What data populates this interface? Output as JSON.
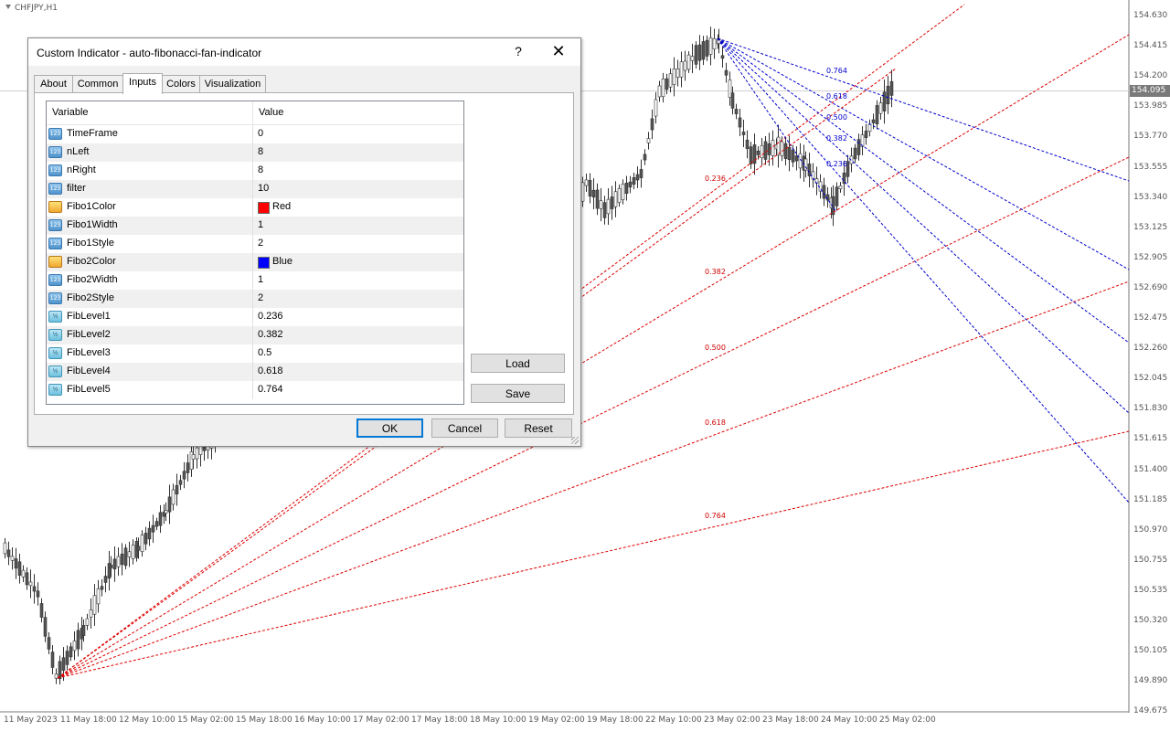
{
  "chart": {
    "symbol": "CHFJPY,H1",
    "current_price": "154.095",
    "price_scale": [
      "154.630",
      "154.415",
      "154.200",
      "153.985",
      "153.770",
      "153.555",
      "153.340",
      "153.125",
      "152.905",
      "152.690",
      "152.475",
      "152.260",
      "152.045",
      "151.830",
      "151.615",
      "151.400",
      "151.185",
      "150.970",
      "150.755",
      "150.535",
      "150.320",
      "150.105",
      "149.890",
      "149.675"
    ],
    "time_scale": [
      "11 May 2023",
      "11 May 18:00",
      "12 May 10:00",
      "15 May 02:00",
      "15 May 18:00",
      "16 May 10:00",
      "17 May 02:00",
      "17 May 18:00",
      "18 May 10:00",
      "19 May 02:00",
      "19 May 18:00",
      "22 May 10:00",
      "23 May 02:00",
      "23 May 18:00",
      "24 May 10:00",
      "25 May 02:00"
    ],
    "red_fan_labels": [
      "0.236",
      "0.382",
      "0.500",
      "0.618",
      "0.764"
    ],
    "blue_fan_labels": [
      "0.764",
      "0.618",
      "0.500",
      "0.382",
      "0.236"
    ],
    "colors": {
      "fan_up": "#dd0000",
      "fan_down": "#0000cc",
      "current_price_bg": "#7a7a7a"
    }
  },
  "dialog": {
    "title": "Custom Indicator - auto-fibonacci-fan-indicator",
    "help_label": "?",
    "close_label": "✕",
    "tabs": [
      "About",
      "Common",
      "Inputs",
      "Colors",
      "Visualization"
    ],
    "active_tab": "Inputs",
    "table": {
      "headers": {
        "variable": "Variable",
        "value": "Value"
      },
      "rows": [
        {
          "name": "TimeFrame",
          "value": "0",
          "icon": "int-icon"
        },
        {
          "name": "nLeft",
          "value": "8",
          "icon": "int-icon"
        },
        {
          "name": "nRight",
          "value": "8",
          "icon": "int-icon"
        },
        {
          "name": "filter",
          "value": "10",
          "icon": "int-icon"
        },
        {
          "name": "Fibo1Color",
          "value": "Red",
          "icon": "color-icon",
          "swatch": "#ff0000"
        },
        {
          "name": "Fibo1Width",
          "value": "1",
          "icon": "int-icon"
        },
        {
          "name": "Fibo1Style",
          "value": "2",
          "icon": "int-icon"
        },
        {
          "name": "Fibo2Color",
          "value": "Blue",
          "icon": "color-icon",
          "swatch": "#0000ff"
        },
        {
          "name": "Fibo2Width",
          "value": "1",
          "icon": "int-icon"
        },
        {
          "name": "Fibo2Style",
          "value": "2",
          "icon": "int-icon"
        },
        {
          "name": "FibLevel1",
          "value": "0.236",
          "icon": "double-icon"
        },
        {
          "name": "FibLevel2",
          "value": "0.382",
          "icon": "double-icon"
        },
        {
          "name": "FibLevel3",
          "value": "0.5",
          "icon": "double-icon"
        },
        {
          "name": "FibLevel4",
          "value": "0.618",
          "icon": "double-icon"
        },
        {
          "name": "FibLevel5",
          "value": "0.764",
          "icon": "double-icon"
        }
      ]
    },
    "buttons": {
      "load": "Load",
      "save": "Save",
      "ok": "OK",
      "cancel": "Cancel",
      "reset": "Reset"
    }
  }
}
